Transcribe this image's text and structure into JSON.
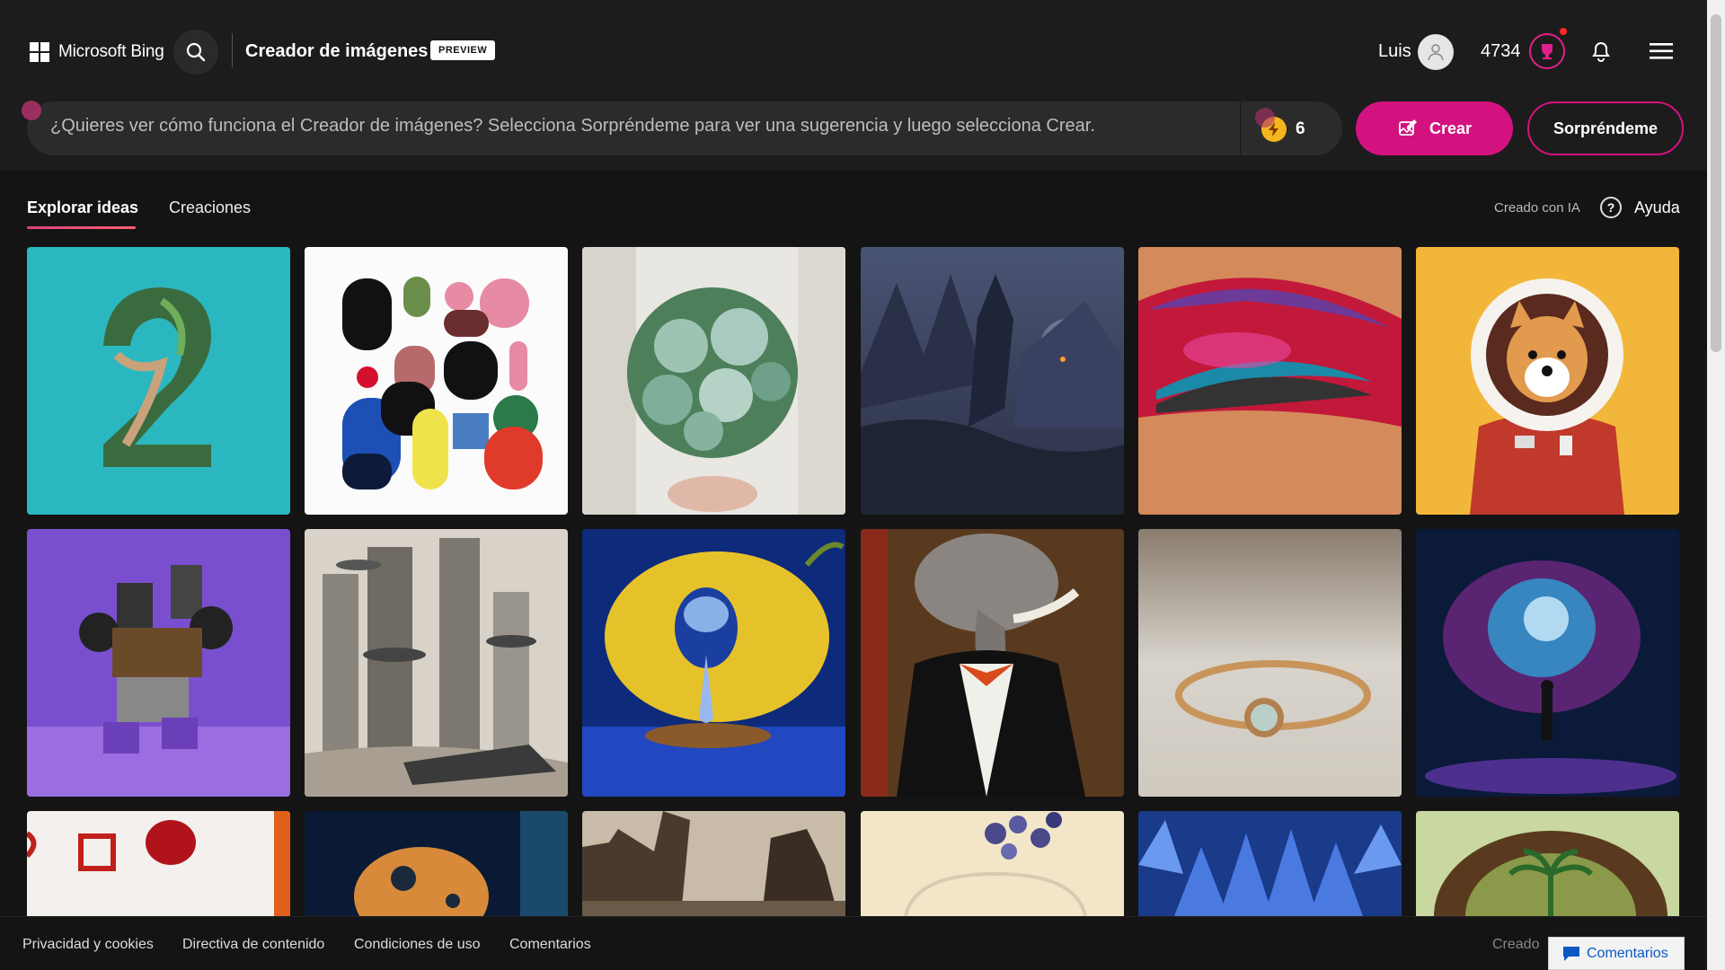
{
  "header": {
    "brand": "Microsoft Bing",
    "app_title": "Creador de imágenes",
    "badge": "PREVIEW",
    "user_name": "Luis",
    "points": "4734"
  },
  "prompt": {
    "placeholder": "¿Quieres ver cómo funciona el Creador de imágenes? Selecciona Sorpréndeme para ver una sugerencia y luego selecciona Crear.",
    "boosts": "6"
  },
  "buttons": {
    "create": "Crear",
    "surprise": "Sorpréndeme"
  },
  "tabs": [
    {
      "label": "Explorar ideas",
      "active": true
    },
    {
      "label": "Creaciones",
      "active": false
    }
  ],
  "made_with_ai": "Creado con IA",
  "help": "Ayuda",
  "gallery": [
    {
      "subject": "number-2-leaf"
    },
    {
      "subject": "abstract-shapes"
    },
    {
      "subject": "succulent-bouquet"
    },
    {
      "subject": "dark-castle-mountains"
    },
    {
      "subject": "colorful-eye-makeup"
    },
    {
      "subject": "shiba-astronaut"
    },
    {
      "subject": "purple-robot"
    },
    {
      "subject": "sci-fi-city"
    },
    {
      "subject": "lemon-teardrop"
    },
    {
      "subject": "elephant-tuxedo"
    },
    {
      "subject": "gold-ring"
    },
    {
      "subject": "cosmic-figure"
    },
    {
      "subject": "red-hat-wall"
    },
    {
      "subject": "space-hamster"
    },
    {
      "subject": "ruined-building"
    },
    {
      "subject": "flower-glass"
    },
    {
      "subject": "blue-flower"
    },
    {
      "subject": "tiny-planet-palm"
    }
  ],
  "footer": {
    "links": [
      "Privacidad y cookies",
      "Directiva de contenido",
      "Condiciones de uso",
      "Comentarios"
    ],
    "created": "Creado",
    "feedback": "Comentarios"
  },
  "colors": {
    "accent": "#d4127f",
    "background": "#141414",
    "header": "#1c1c1c"
  }
}
